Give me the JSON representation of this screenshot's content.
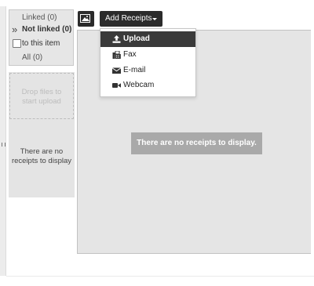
{
  "filters": {
    "linked": "Linked (0)",
    "not_linked": "Not linked (0)",
    "this_item": "to this item",
    "all": "All (0)"
  },
  "drop_zone": {
    "line1": "Drop files to",
    "line2": "start upload"
  },
  "left_empty": {
    "line1": "There are no",
    "line2": "receipts to display"
  },
  "toolbar": {
    "add_receipts_label": "Add Receipts"
  },
  "menu": {
    "items": [
      {
        "label": "Upload",
        "icon": "upload-icon"
      },
      {
        "label": "Fax",
        "icon": "fax-icon"
      },
      {
        "label": "E-mail",
        "icon": "envelope-icon"
      },
      {
        "label": "Webcam",
        "icon": "video-camera-icon"
      }
    ]
  },
  "main": {
    "empty_message": "There are no receipts to display."
  },
  "colors": {
    "button_bg": "#2b2b2b",
    "menu_active_bg": "#3a3a3a",
    "panel_bg": "#e5e5e5",
    "banner_bg": "#a9a9a9"
  }
}
